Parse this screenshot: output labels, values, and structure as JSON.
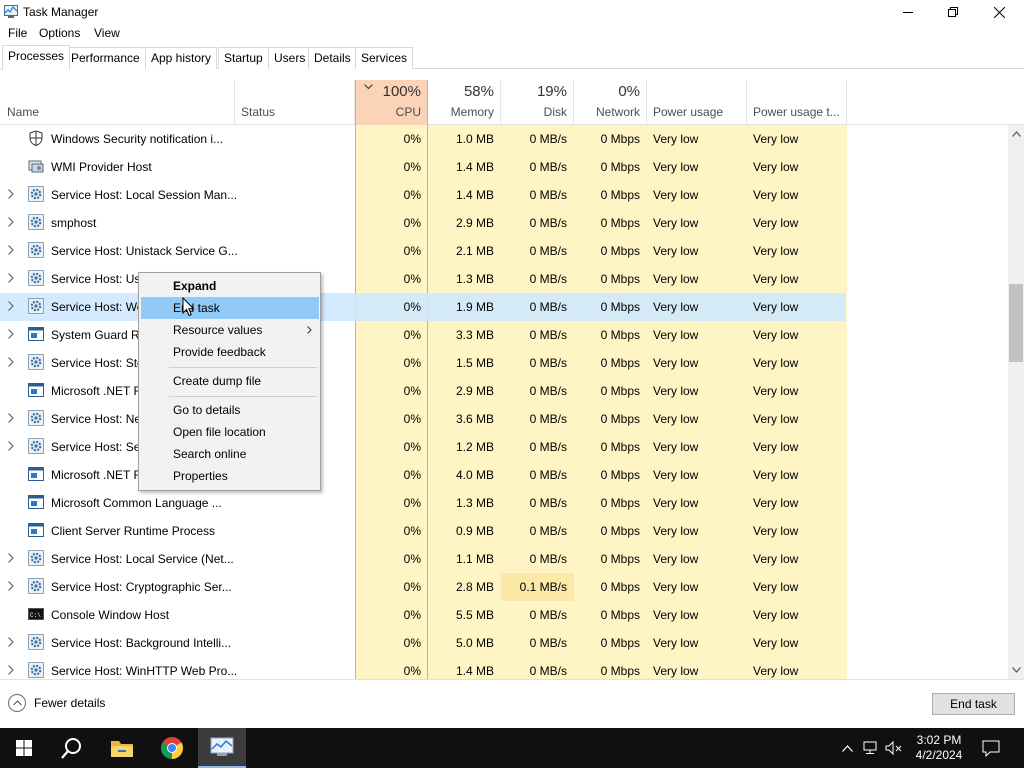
{
  "window": {
    "title": "Task Manager"
  },
  "menu": [
    "File",
    "Options",
    "View"
  ],
  "tabs": [
    "Processes",
    "Performance",
    "App history",
    "Startup",
    "Users",
    "Details",
    "Services"
  ],
  "columns": {
    "name": "Name",
    "status": "Status",
    "cpu": {
      "pct": "100%",
      "label": "CPU"
    },
    "memory": {
      "pct": "58%",
      "label": "Memory"
    },
    "disk": {
      "pct": "19%",
      "label": "Disk"
    },
    "network": {
      "pct": "0%",
      "label": "Network"
    },
    "power": "Power usage",
    "power_trend": "Power usage t..."
  },
  "rows": [
    {
      "name": "Windows Security notification i...",
      "cpu": "0%",
      "mem": "1.0 MB",
      "disk": "0 MB/s",
      "net": "0 Mbps",
      "power": "Very low",
      "trend": "Very low",
      "icon": "shield-icon",
      "expandable": false
    },
    {
      "name": "WMI Provider Host",
      "cpu": "0%",
      "mem": "1.4 MB",
      "disk": "0 MB/s",
      "net": "0 Mbps",
      "power": "Very low",
      "trend": "Very low",
      "icon": "wmi-icon",
      "expandable": false
    },
    {
      "name": "Service Host: Local Session Man...",
      "cpu": "0%",
      "mem": "1.4 MB",
      "disk": "0 MB/s",
      "net": "0 Mbps",
      "power": "Very low",
      "trend": "Very low",
      "icon": "gear-icon",
      "expandable": true
    },
    {
      "name": "smphost",
      "cpu": "0%",
      "mem": "2.9 MB",
      "disk": "0 MB/s",
      "net": "0 Mbps",
      "power": "Very low",
      "trend": "Very low",
      "icon": "gear-icon",
      "expandable": true
    },
    {
      "name": "Service Host: Unistack Service G...",
      "cpu": "0%",
      "mem": "2.1 MB",
      "disk": "0 MB/s",
      "net": "0 Mbps",
      "power": "Very low",
      "trend": "Very low",
      "icon": "gear-icon",
      "expandable": true
    },
    {
      "name": "Service Host: Use",
      "cpu": "0%",
      "mem": "1.3 MB",
      "disk": "0 MB/s",
      "net": "0 Mbps",
      "power": "Very low",
      "trend": "Very low",
      "icon": "gear-icon",
      "expandable": true
    },
    {
      "name": "Service Host: We",
      "cpu": "0%",
      "mem": "1.9 MB",
      "disk": "0 MB/s",
      "net": "0 Mbps",
      "power": "Very low",
      "trend": "Very low",
      "icon": "gear-icon",
      "expandable": true,
      "selected": true
    },
    {
      "name": "System Guard Ru",
      "cpu": "0%",
      "mem": "3.3 MB",
      "disk": "0 MB/s",
      "net": "0 Mbps",
      "power": "Very low",
      "trend": "Very low",
      "icon": "window-icon",
      "expandable": true
    },
    {
      "name": "Service Host: Sto",
      "cpu": "0%",
      "mem": "1.5 MB",
      "disk": "0 MB/s",
      "net": "0 Mbps",
      "power": "Very low",
      "trend": "Very low",
      "icon": "gear-icon",
      "expandable": true
    },
    {
      "name": "Microsoft .NET F",
      "cpu": "0%",
      "mem": "2.9 MB",
      "disk": "0 MB/s",
      "net": "0 Mbps",
      "power": "Very low",
      "trend": "Very low",
      "icon": "window-icon",
      "expandable": false
    },
    {
      "name": "Service Host: Ne",
      "cpu": "0%",
      "mem": "3.6 MB",
      "disk": "0 MB/s",
      "net": "0 Mbps",
      "power": "Very low",
      "trend": "Very low",
      "icon": "gear-icon",
      "expandable": true
    },
    {
      "name": "Service Host: Ser",
      "cpu": "0%",
      "mem": "1.2 MB",
      "disk": "0 MB/s",
      "net": "0 Mbps",
      "power": "Very low",
      "trend": "Very low",
      "icon": "gear-icon",
      "expandable": true
    },
    {
      "name": "Microsoft .NET F",
      "cpu": "0%",
      "mem": "4.0 MB",
      "disk": "0 MB/s",
      "net": "0 Mbps",
      "power": "Very low",
      "trend": "Very low",
      "icon": "window-icon",
      "expandable": false
    },
    {
      "name": "Microsoft Common Language ...",
      "cpu": "0%",
      "mem": "1.3 MB",
      "disk": "0 MB/s",
      "net": "0 Mbps",
      "power": "Very low",
      "trend": "Very low",
      "icon": "window-icon",
      "expandable": false
    },
    {
      "name": "Client Server Runtime Process",
      "cpu": "0%",
      "mem": "0.9 MB",
      "disk": "0 MB/s",
      "net": "0 Mbps",
      "power": "Very low",
      "trend": "Very low",
      "icon": "window-icon",
      "expandable": false
    },
    {
      "name": "Service Host: Local Service (Net...",
      "cpu": "0%",
      "mem": "1.1 MB",
      "disk": "0 MB/s",
      "net": "0 Mbps",
      "power": "Very low",
      "trend": "Very low",
      "icon": "gear-icon",
      "expandable": true
    },
    {
      "name": "Service Host: Cryptographic Ser...",
      "cpu": "0%",
      "mem": "2.8 MB",
      "disk": "0.1 MB/s",
      "net": "0 Mbps",
      "power": "Very low",
      "trend": "Very low",
      "icon": "gear-icon",
      "expandable": true,
      "disk_hi": true
    },
    {
      "name": "Console Window Host",
      "cpu": "0%",
      "mem": "5.5 MB",
      "disk": "0 MB/s",
      "net": "0 Mbps",
      "power": "Very low",
      "trend": "Very low",
      "icon": "console-icon",
      "expandable": false
    },
    {
      "name": "Service Host: Background Intelli...",
      "cpu": "0%",
      "mem": "5.0 MB",
      "disk": "0 MB/s",
      "net": "0 Mbps",
      "power": "Very low",
      "trend": "Very low",
      "icon": "gear-icon",
      "expandable": true
    },
    {
      "name": "Service Host: WinHTTP Web Pro...",
      "cpu": "0%",
      "mem": "1.4 MB",
      "disk": "0 MB/s",
      "net": "0 Mbps",
      "power": "Very low",
      "trend": "Very low",
      "icon": "gear-icon",
      "expandable": true
    }
  ],
  "context_menu": [
    {
      "label": "Expand",
      "bold": true
    },
    {
      "label": "End task",
      "hover": true
    },
    {
      "label": "Resource values",
      "submenu": true
    },
    {
      "label": "Provide feedback"
    },
    {
      "label": "Create dump file"
    },
    {
      "label": "Go to details"
    },
    {
      "label": "Open file location"
    },
    {
      "label": "Search online"
    },
    {
      "label": "Properties"
    }
  ],
  "footer": {
    "fewer_details": "Fewer details",
    "end_task": "End task"
  },
  "taskbar": {
    "time": "3:02 PM",
    "date": "4/2/2024"
  },
  "colors": {
    "cpu_heavy": "#fbd3b6",
    "usage": "#fff4c4",
    "usage_mid": "#fde9a7",
    "selection": "#cce8ff",
    "menu_hover": "#91c9f7"
  }
}
